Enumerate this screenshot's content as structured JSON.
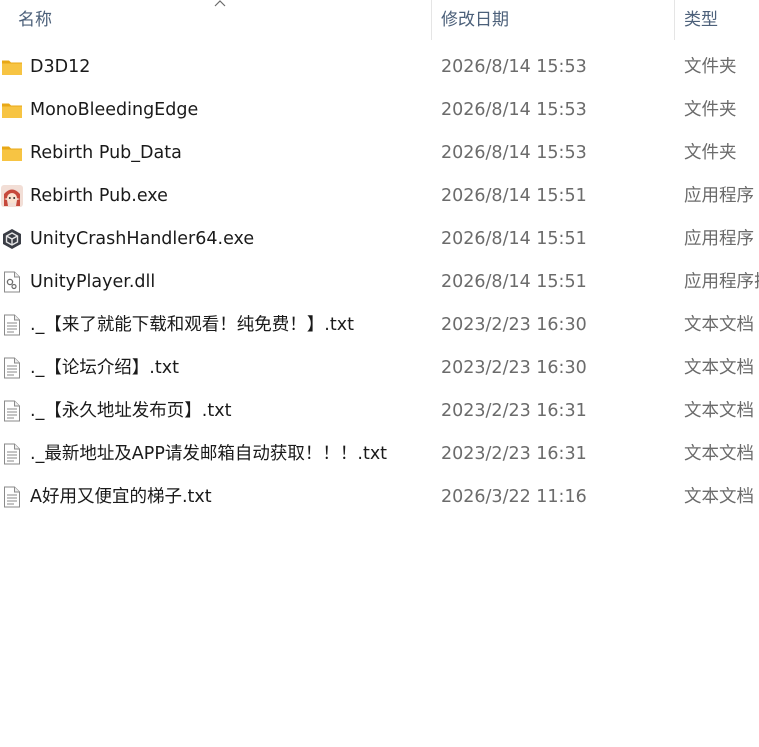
{
  "columns": {
    "name": "名称",
    "date": "修改日期",
    "type": "类型"
  },
  "files": [
    {
      "name": "D3D12",
      "date": "2026/8/14 15:53",
      "type": "文件夹",
      "icon": "folder-icon"
    },
    {
      "name": "MonoBleedingEdge",
      "date": "2026/8/14 15:53",
      "type": "文件夹",
      "icon": "folder-icon"
    },
    {
      "name": "Rebirth Pub_Data",
      "date": "2026/8/14 15:53",
      "type": "文件夹",
      "icon": "folder-icon"
    },
    {
      "name": "Rebirth Pub.exe",
      "date": "2026/8/14 15:51",
      "type": "应用程序",
      "icon": "game-app-icon"
    },
    {
      "name": "UnityCrashHandler64.exe",
      "date": "2026/8/14 15:51",
      "type": "应用程序",
      "icon": "unity-app-icon"
    },
    {
      "name": "UnityPlayer.dll",
      "date": "2026/8/14 15:51",
      "type": "应用程序扩展",
      "icon": "dll-file-icon"
    },
    {
      "name": "._【来了就能下载和观看！纯免费！】.txt",
      "date": "2023/2/23 16:30",
      "type": "文本文档",
      "icon": "text-file-icon"
    },
    {
      "name": "._【论坛介绍】.txt",
      "date": "2023/2/23 16:30",
      "type": "文本文档",
      "icon": "text-file-icon"
    },
    {
      "name": "._【永久地址发布页】.txt",
      "date": "2023/2/23 16:31",
      "type": "文本文档",
      "icon": "text-file-icon"
    },
    {
      "name": "._最新地址及APP请发邮箱自动获取！！！.txt",
      "date": "2023/2/23 16:31",
      "type": "文本文档",
      "icon": "text-file-icon"
    },
    {
      "name": "A好用又便宜的梯子.txt",
      "date": "2026/3/22 11:16",
      "type": "文本文档",
      "icon": "text-file-icon"
    }
  ],
  "colors": {
    "header_text": "#4c607a",
    "folder": "#f7c443",
    "date_text": "#6b6b6b"
  }
}
